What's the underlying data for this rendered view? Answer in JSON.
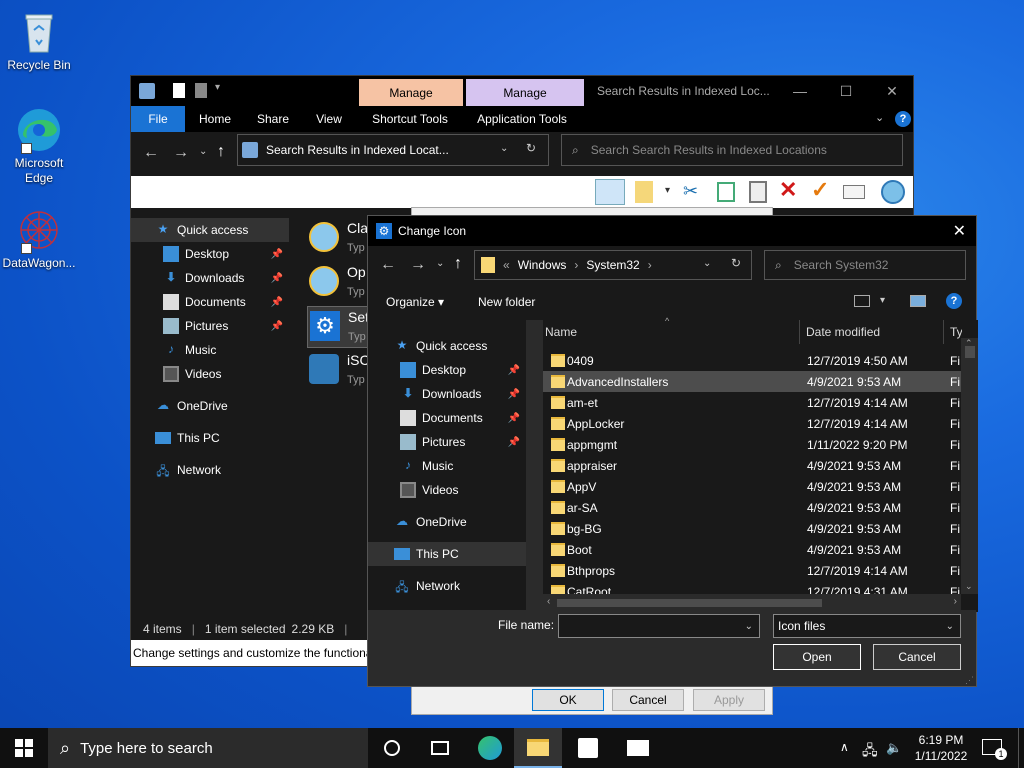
{
  "desktop": {
    "icons": [
      {
        "label": "Recycle Bin"
      },
      {
        "label": "Microsoft Edge"
      },
      {
        "label": "DataWagon..."
      }
    ]
  },
  "explorer": {
    "context_tabs": [
      "Manage",
      "Manage"
    ],
    "title": "Search Results in Indexed Loc...",
    "ribbon_tabs": [
      "File",
      "Home",
      "Share",
      "View",
      "Shortcut Tools",
      "Application Tools"
    ],
    "address": "Search Results in Indexed Locat...",
    "search_placeholder": "Search Search Results in Indexed Locations",
    "nav": [
      {
        "label": "Quick access",
        "pinned": false
      },
      {
        "label": "Desktop",
        "pinned": true
      },
      {
        "label": "Downloads",
        "pinned": true
      },
      {
        "label": "Documents",
        "pinned": true
      },
      {
        "label": "Pictures",
        "pinned": true
      },
      {
        "label": "Music",
        "pinned": false
      },
      {
        "label": "Videos",
        "pinned": false
      },
      {
        "label": "OneDrive",
        "pinned": false
      },
      {
        "label": "This PC",
        "pinned": false
      },
      {
        "label": "Network",
        "pinned": false
      }
    ],
    "results": [
      {
        "name": "Cla",
        "type": "Typ"
      },
      {
        "name": "Op",
        "type": "Typ"
      },
      {
        "name": "Set",
        "type": "Typ"
      },
      {
        "name": "iSC",
        "type": "Typ"
      }
    ],
    "status": {
      "items": "4 items",
      "selected": "1 item selected",
      "size": "2.29 KB"
    },
    "description": "Change settings and customize the functiona"
  },
  "properties": {
    "buttons": [
      "OK",
      "Cancel",
      "Apply"
    ]
  },
  "dialog": {
    "title": "Change Icon",
    "breadcrumb": [
      "«",
      "Windows",
      "System32"
    ],
    "search_placeholder": "Search System32",
    "organize": "Organize",
    "new_folder": "New folder",
    "nav": [
      {
        "label": "Quick access",
        "pinned": false
      },
      {
        "label": "Desktop",
        "pinned": true
      },
      {
        "label": "Downloads",
        "pinned": true
      },
      {
        "label": "Documents",
        "pinned": true
      },
      {
        "label": "Pictures",
        "pinned": true
      },
      {
        "label": "Music",
        "pinned": false
      },
      {
        "label": "Videos",
        "pinned": false
      },
      {
        "label": "OneDrive",
        "pinned": false
      },
      {
        "label": "This PC",
        "pinned": false
      },
      {
        "label": "Network",
        "pinned": false
      }
    ],
    "columns": [
      "Name",
      "Date modified",
      "Ty"
    ],
    "files": [
      {
        "name": "0409",
        "date": "12/7/2019 4:50 AM",
        "type": "Fi"
      },
      {
        "name": "AdvancedInstallers",
        "date": "4/9/2021 9:53 AM",
        "type": "Fi"
      },
      {
        "name": "am-et",
        "date": "12/7/2019 4:14 AM",
        "type": "Fi"
      },
      {
        "name": "AppLocker",
        "date": "12/7/2019 4:14 AM",
        "type": "Fi"
      },
      {
        "name": "appmgmt",
        "date": "1/11/2022 9:20 PM",
        "type": "Fi"
      },
      {
        "name": "appraiser",
        "date": "4/9/2021 9:53 AM",
        "type": "Fi"
      },
      {
        "name": "AppV",
        "date": "4/9/2021 9:53 AM",
        "type": "Fi"
      },
      {
        "name": "ar-SA",
        "date": "4/9/2021 9:53 AM",
        "type": "Fi"
      },
      {
        "name": "bg-BG",
        "date": "4/9/2021 9:53 AM",
        "type": "Fi"
      },
      {
        "name": "Boot",
        "date": "4/9/2021 9:53 AM",
        "type": "Fi"
      },
      {
        "name": "Bthprops",
        "date": "12/7/2019 4:14 AM",
        "type": "Fi"
      },
      {
        "name": "CatRoot",
        "date": "12/7/2019 4:31 AM",
        "type": "Fi"
      }
    ],
    "selected_file": "AdvancedInstallers",
    "file_name_label": "File name:",
    "file_name_value": "",
    "file_type": "Icon files",
    "open": "Open",
    "cancel": "Cancel"
  },
  "taskbar": {
    "search_placeholder": "Type here to search",
    "time": "6:19 PM",
    "date": "1/11/2022",
    "notification_count": "1"
  }
}
